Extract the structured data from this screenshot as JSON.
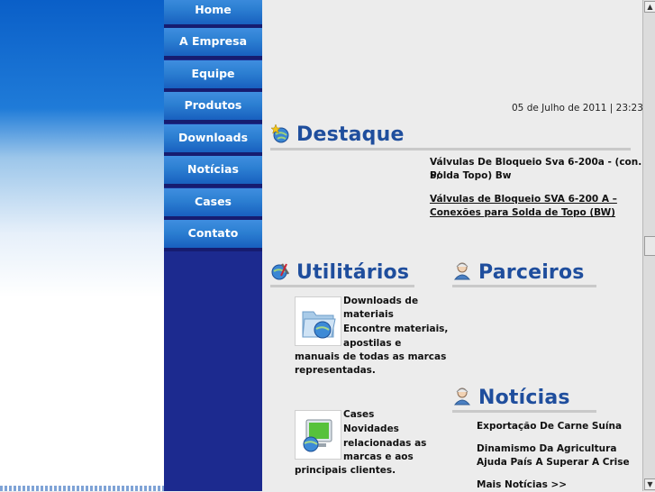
{
  "nav": {
    "items": [
      "Home",
      "A Empresa",
      "Equipe",
      "Produtos",
      "Downloads",
      "Notícias",
      "Cases",
      "Contato"
    ]
  },
  "date_text": "05 de Julho de 2011 | 23:23",
  "destaque": {
    "title": "Destaque",
    "headline": [
      "Válvulas De Bloqueio Sva 6-200a - (con. P/",
      "Solda Topo) Bw"
    ],
    "link": [
      "Válvulas de Bloqueio SVA 6-200 A –",
      "Conexões para Solda de Topo (BW)"
    ]
  },
  "utilitarios": {
    "title": "Utilitários",
    "downloads": {
      "title_lines": [
        "Downloads de",
        "materiais"
      ],
      "desc_lines": [
        "Encontre materiais,",
        "apostilas e",
        "manuais de todas as marcas",
        "representadas."
      ]
    },
    "cases": {
      "title": "Cases",
      "desc_lines": [
        "Novidades",
        "relacionadas as",
        "marcas e aos",
        "principais clientes."
      ]
    }
  },
  "parceiros": {
    "title": "Parceiros"
  },
  "noticias": {
    "title": "Notícias",
    "items": [
      "Exportação De Carne Suína",
      "Dinamismo Da Agricultura",
      "Ajuda País A Superar A Crise",
      "Mais Notícias >>"
    ]
  },
  "colors": {
    "title_blue": "#1f4e9d",
    "nav_dark": "#1c2a8f",
    "nav_button": "#2c7fd2"
  }
}
